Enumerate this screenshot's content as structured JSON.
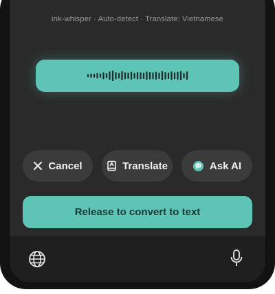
{
  "status_line": "ink-whisper · Auto-detect · Translate: Vietnamese",
  "waveform": {
    "levels": [
      0.25,
      0.35,
      0.3,
      0.45,
      0.35,
      0.55,
      0.4,
      0.7,
      0.85,
      0.6,
      0.45,
      0.75,
      0.55,
      0.5,
      0.65,
      0.45,
      0.6,
      0.55,
      0.5,
      0.7,
      0.6,
      0.55,
      0.65,
      0.5,
      0.75,
      0.6,
      0.5,
      0.7,
      0.55,
      0.65,
      0.75,
      0.45,
      0.7
    ]
  },
  "actions": {
    "cancel_label": "Cancel",
    "translate_label": "Translate",
    "ask_ai_label": "Ask AI"
  },
  "release_label": "Release to convert to text",
  "colors": {
    "accent": "#5ec4b5",
    "chip_bg": "#3b3b3b",
    "background": "#2a2a2a"
  }
}
